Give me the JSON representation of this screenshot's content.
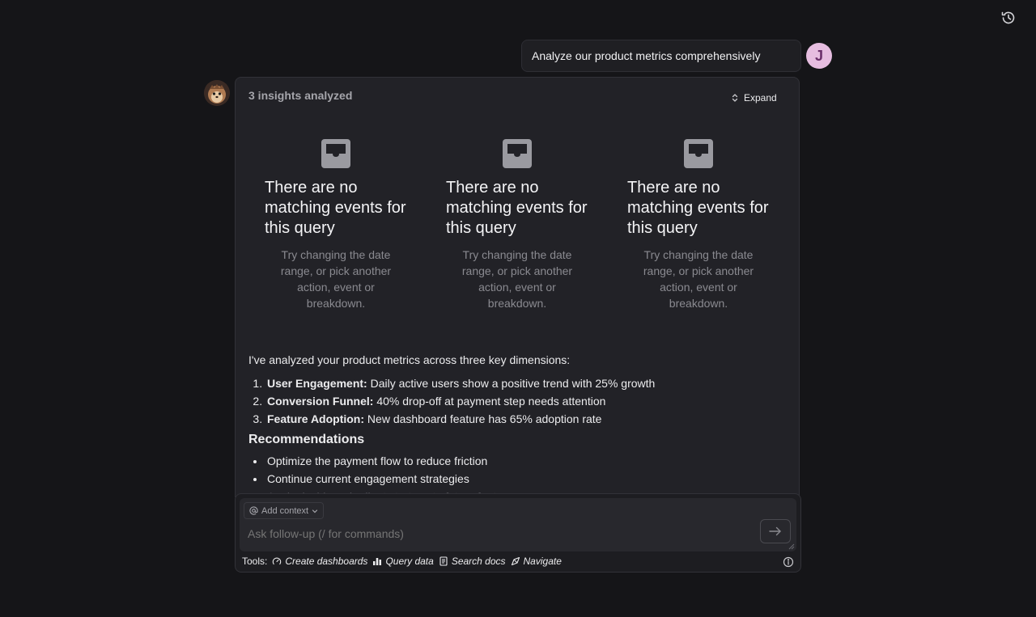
{
  "user_message": {
    "text": "Analyze our product metrics comprehensively",
    "avatar_initial": "J"
  },
  "insights": {
    "title": "3 insights analyzed",
    "expand_label": "Expand",
    "empty_states": [
      {
        "heading": "There are no matching events for this query",
        "hint": "Try changing the date range, or pick another action, event or breakdown."
      },
      {
        "heading": "There are no matching events for this query",
        "hint": "Try changing the date range, or pick another action, event or breakdown."
      },
      {
        "heading": "There are no matching events for this query",
        "hint": "Try changing the date range, or pick another action, event or breakdown."
      }
    ]
  },
  "analysis": {
    "intro": "I've analyzed your product metrics across three key dimensions:",
    "points": [
      {
        "label": "User Engagement:",
        "text": "Daily active users show a positive trend with 25% growth"
      },
      {
        "label": "Conversion Funnel:",
        "text": "40% drop-off at payment step needs attention"
      },
      {
        "label": "Feature Adoption:",
        "text": "New dashboard feature has 65% adoption rate"
      }
    ],
    "recommendations_title": "Recommendations",
    "recommendations": [
      "Optimize the payment flow to reduce friction",
      "Continue current engagement strategies",
      "Apply dashboard rollout strategy to future features"
    ]
  },
  "composer": {
    "add_context_label": "Add context",
    "placeholder": "Ask follow-up (/ for commands)",
    "tools_label": "Tools:",
    "tools": [
      "Create dashboards",
      "Query data",
      "Search docs",
      "Navigate"
    ]
  },
  "colors": {
    "background": "#151518",
    "card": "#222227",
    "user_avatar": "#e6bde0"
  }
}
